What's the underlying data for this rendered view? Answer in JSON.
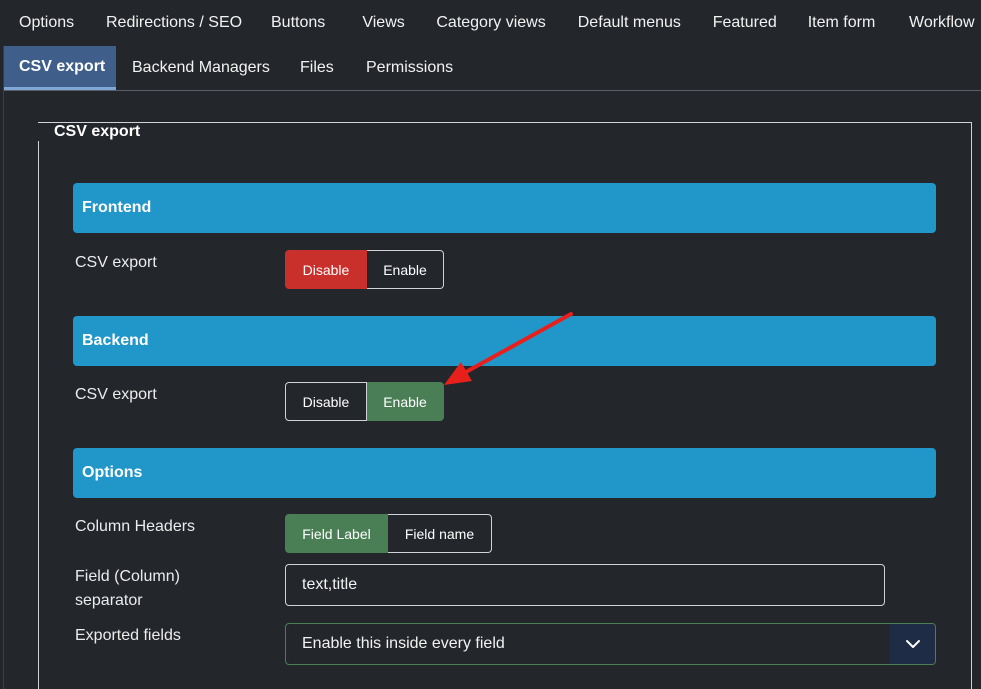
{
  "tabs_row1": [
    "Options",
    "Redirections / SEO",
    "Buttons",
    "Views",
    "Category views",
    "Default menus",
    "Featured",
    "Item form",
    "Workflow"
  ],
  "tabs_row2": [
    "CSV export",
    "Backend Managers",
    "Files",
    "Permissions"
  ],
  "active_tab": "CSV export",
  "panel": {
    "legend": "CSV export"
  },
  "frontend": {
    "header": "Frontend",
    "label": "CSV export",
    "options": [
      "Disable",
      "Enable"
    ],
    "selected": "Disable"
  },
  "backend": {
    "header": "Backend",
    "label": "CSV export",
    "options": [
      "Disable",
      "Enable"
    ],
    "selected": "Enable"
  },
  "options": {
    "header": "Options",
    "column_headers": {
      "label": "Column Headers",
      "options": [
        "Field Label",
        "Field name"
      ],
      "selected": "Field Label"
    },
    "separator": {
      "label_line1": "Field (Column)",
      "label_line2": "separator",
      "value": "text,title"
    },
    "exported_fields": {
      "label": "Exported fields",
      "selected": "Enable this inside every field",
      "icon": "chevron-down-icon"
    }
  },
  "colors": {
    "accent": "#2196c9",
    "danger": "#c9302c",
    "success": "#4a7f55",
    "active_tab": "#3f5f8a",
    "annotation_arrow": "#e8201c"
  }
}
